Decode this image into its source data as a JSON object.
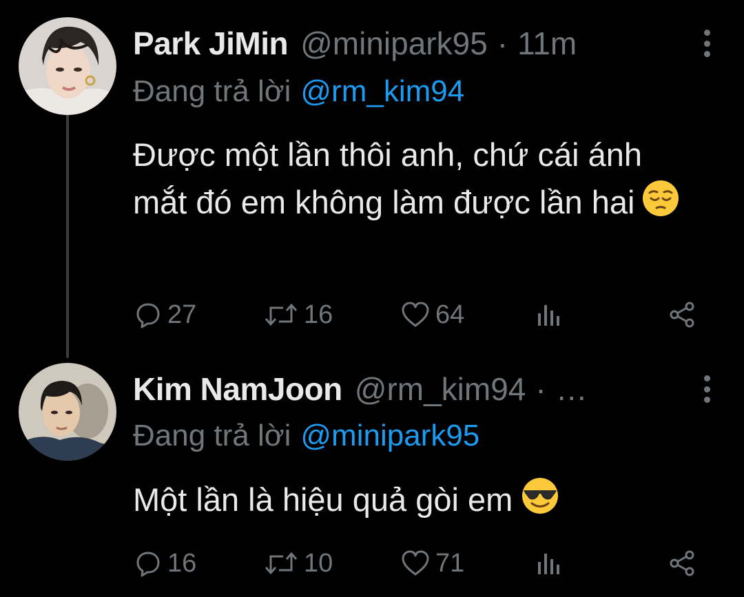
{
  "tweets": [
    {
      "display_name": "Park JiMin",
      "handle": "@minipark95",
      "separator": "·",
      "time": "11m",
      "reply_prefix": "Đang trả lời",
      "reply_to": "@rm_kim94",
      "text": "Được một lần thôi anh, chứ cái ánh mắt đó em không làm được lần hai",
      "emoji": "pensive-face",
      "replies": "27",
      "retweets": "16",
      "likes": "64"
    },
    {
      "display_name": "Kim NamJoon",
      "handle": "@rm_kim94",
      "separator": "·",
      "time": "…",
      "reply_prefix": "Đang trả lời",
      "reply_to": "@minipark95",
      "text": "Một lần là hiệu quả gòi em",
      "emoji": "smiling-face-with-sunglasses",
      "replies": "16",
      "retweets": "10",
      "likes": "71"
    }
  ],
  "colors": {
    "background": "#000000",
    "text": "#e7e9ea",
    "muted": "#71767b",
    "mention": "#1d9bf0",
    "thread_line": "#3a3d40"
  },
  "icons": [
    "reply-icon",
    "retweet-icon",
    "like-icon",
    "analytics-icon",
    "share-icon",
    "more-icon"
  ]
}
